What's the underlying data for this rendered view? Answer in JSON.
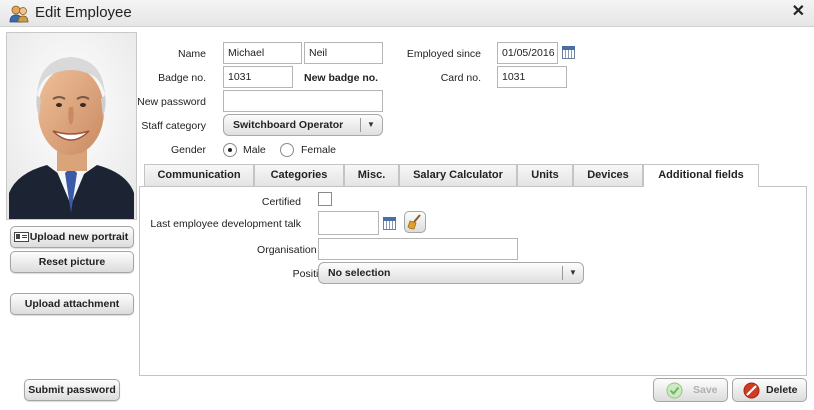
{
  "window": {
    "title": "Edit Employee"
  },
  "left": {
    "upload_portrait": "Upload new portrait",
    "reset_picture": "Reset picture",
    "upload_attachment": "Upload attachment",
    "submit_password": "Submit password"
  },
  "form": {
    "name_label": "Name",
    "first_name": "Michael",
    "last_name": "Neil",
    "employed_since_label": "Employed since",
    "employed_since": "01/05/2016",
    "badge_label": "Badge no.",
    "badge_no": "1031",
    "new_badge": "New badge no.",
    "card_label": "Card no.",
    "card_no": "1031",
    "password_label": "New password",
    "password": "",
    "staff_category_label": "Staff category",
    "staff_category": "Switchboard Operator",
    "gender_label": "Gender",
    "gender_options": [
      "Male",
      "Female"
    ],
    "gender_selected": "Male"
  },
  "tabs": [
    "Communication",
    "Categories",
    "Misc.",
    "Salary Calculator",
    "Units",
    "Devices",
    "Additional fields"
  ],
  "active_tab": "Additional fields",
  "additional": {
    "certified_label": "Certified",
    "dev_talk_label": "Last employee development talk",
    "dev_talk_value": "",
    "org_id_label": "Organisation ID",
    "org_id_value": "",
    "position_label": "Position",
    "position_value": "No selection"
  },
  "actions": {
    "save": "Save",
    "delete": "Delete"
  },
  "colors": {
    "save_disabled_text": "#b0b0b0",
    "delete_red": "#d33a1f",
    "save_green": "#7fc96a"
  }
}
